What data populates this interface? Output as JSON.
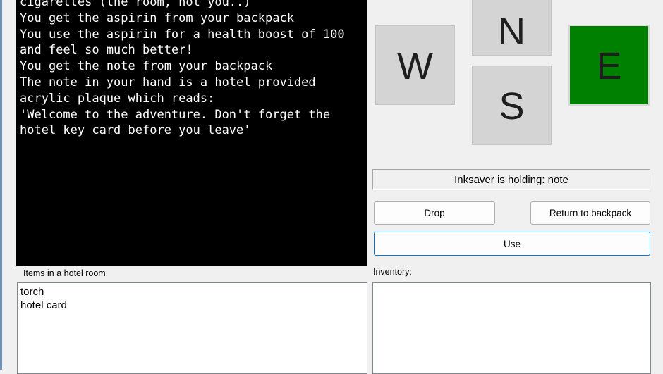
{
  "colors": {
    "console_bg": "#000000",
    "console_text": "#ffffff",
    "east_button": "#008000",
    "direction_button": "#d4d4d4",
    "use_button_border": "#0078d7"
  },
  "console": {
    "lines": [
      "cigarettes (the room, not you..)",
      "You get the aspirin from your backpack",
      "You use the aspirin for a health boost of 100",
      "and feel so much better!",
      "You get the note from your backpack",
      "The note in your hand is a hotel provided",
      "acrylic plaque which reads:",
      "'Welcome to the adventure. Don't forget the",
      "hotel key card before you leave'"
    ]
  },
  "directions": {
    "north": "N",
    "west": "W",
    "south": "S",
    "east": "E"
  },
  "status": {
    "holding": "Inksaver is holding: note"
  },
  "actions": {
    "drop": "Drop",
    "return": "Return to backpack",
    "use": "Use"
  },
  "room": {
    "label": "Items in a hotel room",
    "items": [
      "torch",
      "hotel card"
    ]
  },
  "inventory": {
    "label": "Inventory:",
    "items": []
  }
}
